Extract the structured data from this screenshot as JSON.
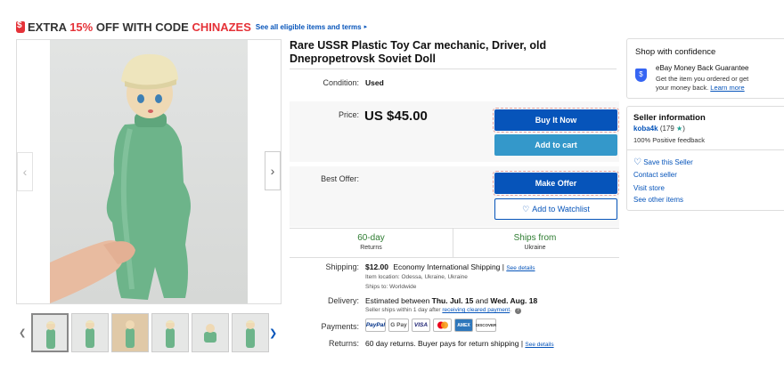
{
  "promo": {
    "prefix": "EXTRA ",
    "percent": "15%",
    "mid": " OFF WITH CODE ",
    "code": "CHINAZES",
    "see_all": "See all eligible items and terms"
  },
  "listing": {
    "title": "Rare USSR Plastic Toy Car mechanic, Driver, old Dnepropetrovsk Soviet Doll",
    "condition_label": "Condition:",
    "condition_value": "Used",
    "price_label": "Price:",
    "price": "US $45.00",
    "best_offer_label": "Best Offer:"
  },
  "buttons": {
    "buy_now": "Buy It Now",
    "add_to_cart": "Add to cart",
    "make_offer": "Make Offer",
    "watchlist": "Add to Watchlist"
  },
  "features": {
    "returns_main": "60-day",
    "returns_sub": "Returns",
    "ships_main": "Ships from",
    "ships_sub": "Ukraine"
  },
  "shipping": {
    "label": "Shipping:",
    "cost": "$12.00",
    "method": "Economy International Shipping |",
    "see_details": "See details",
    "location": "Item location:  Odessa, Ukraine, Ukraine",
    "ships_to": "Ships to:  Worldwide"
  },
  "delivery": {
    "label": "Delivery:",
    "estimate": "Estimated between ",
    "date1": "Thu. Jul. 15",
    "and": " and ",
    "date2": "Wed. Aug. 18",
    "note": "Seller ships within 1 day after ",
    "note_link": "receiving cleared payment",
    "note_end": "."
  },
  "payments": {
    "label": "Payments:",
    "methods": [
      "PayPal",
      "G Pay",
      "VISA",
      "MC",
      "AMEX",
      "DISCOVER"
    ]
  },
  "returns": {
    "label": "Returns:",
    "text": "60 day returns. Buyer pays for return shipping |",
    "see_details": "See details"
  },
  "confidence": {
    "title": "Shop with confidence",
    "guarantee": "eBay Money Back Guarantee",
    "desc1": "Get the item you ordered or get",
    "desc2": "your money back. ",
    "learn_more": "Learn more"
  },
  "seller": {
    "title": "Seller information",
    "name": "koba4k",
    "score": "(179 ",
    "score_end": ")",
    "feedback": "100% Positive feedback",
    "save": "Save this Seller",
    "contact": "Contact seller",
    "visit": "Visit store",
    "other": "See other items"
  },
  "colors": {
    "link": "#0654ba",
    "buy": "#0654ba",
    "cart": "#3498ca",
    "promo_red": "#e53238",
    "green": "#2f7d32",
    "doll_green": "#6db48a",
    "doll_hat": "#eee5bd"
  }
}
